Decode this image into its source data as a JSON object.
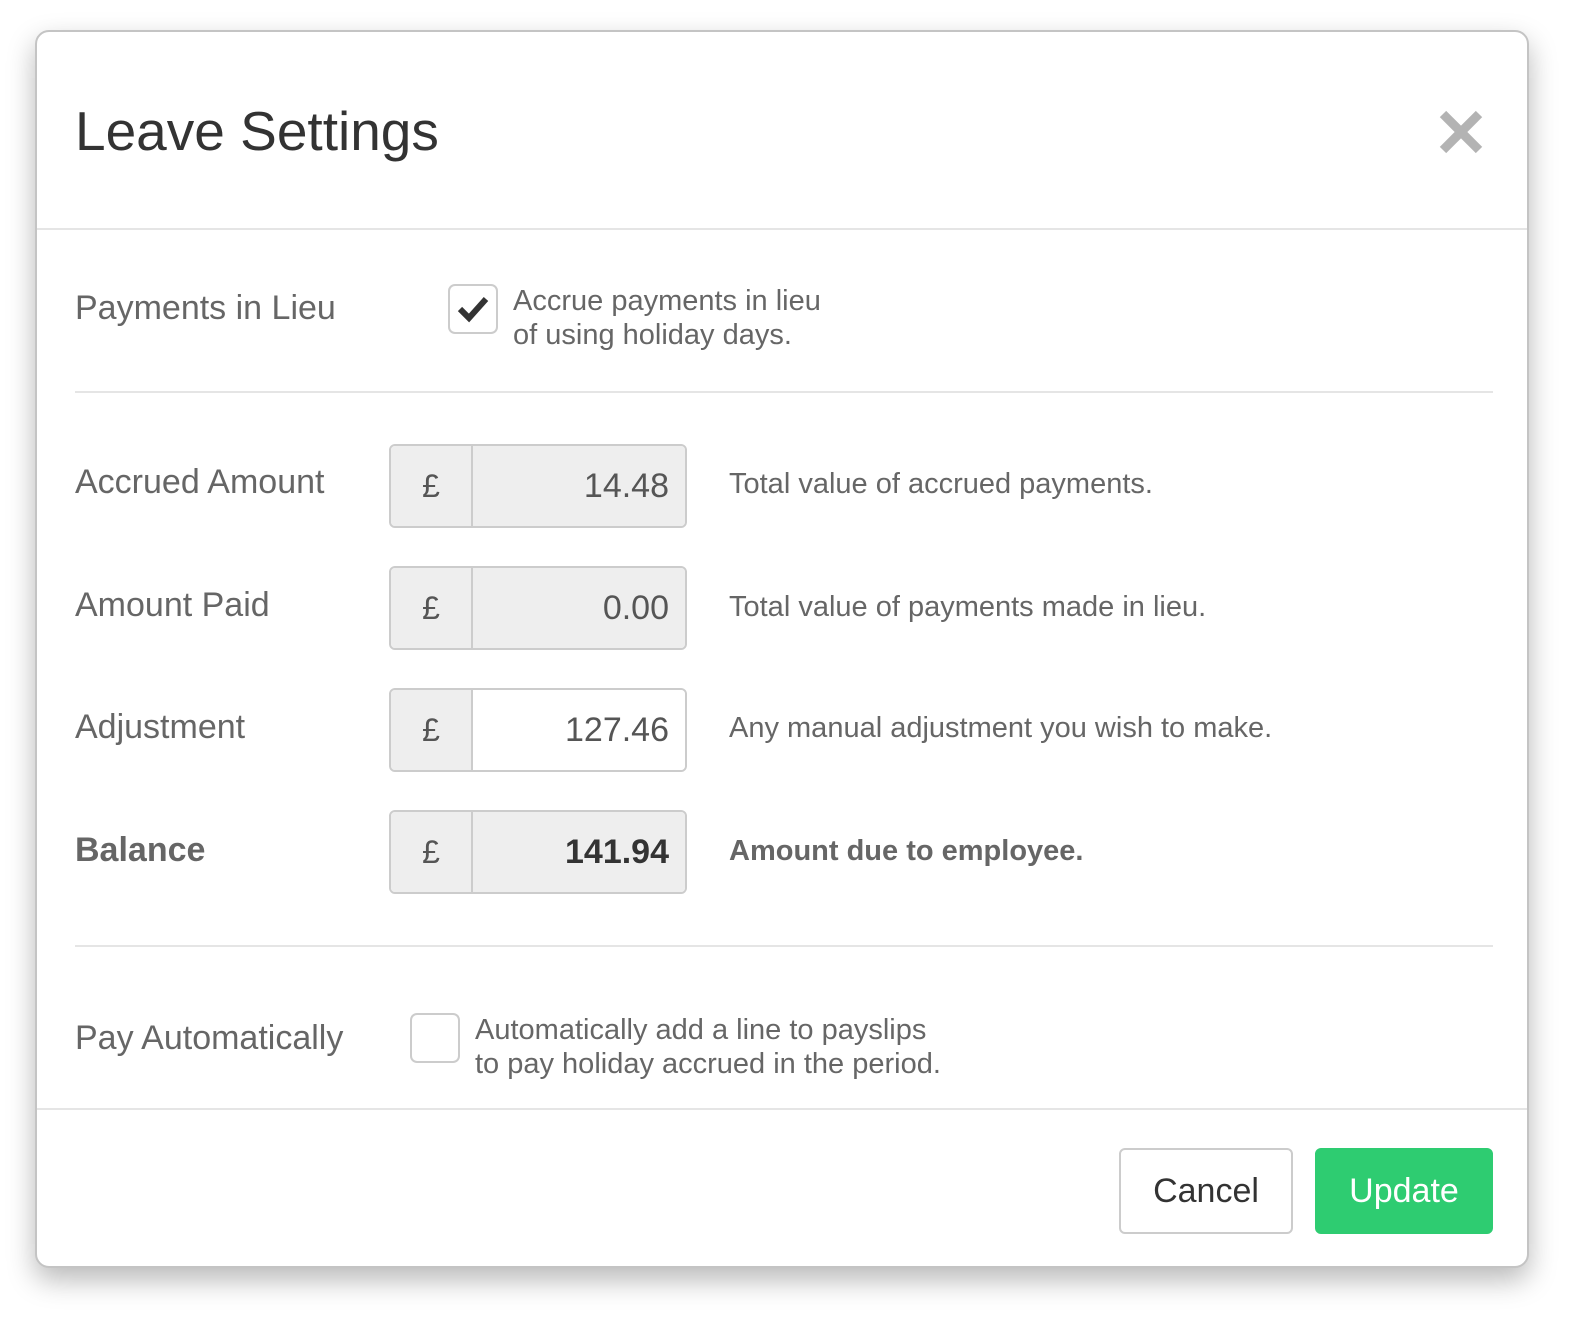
{
  "dialog": {
    "title": "Leave Settings"
  },
  "payments_in_lieu": {
    "label": "Payments in Lieu",
    "checked": true,
    "description_line1": "Accrue payments in lieu",
    "description_line2": "of using holiday days."
  },
  "currency_symbol": "£",
  "fields": {
    "accrued_amount": {
      "label": "Accrued Amount",
      "value": "14.48",
      "help": "Total value of accrued payments."
    },
    "amount_paid": {
      "label": "Amount Paid",
      "value": "0.00",
      "help": "Total value of payments made in lieu."
    },
    "adjustment": {
      "label": "Adjustment",
      "value": "127.46",
      "help": "Any manual adjustment you wish to make."
    },
    "balance": {
      "label": "Balance",
      "value": "141.94",
      "help": "Amount due to employee."
    }
  },
  "pay_automatically": {
    "label": "Pay Automatically",
    "checked": false,
    "description_line1": "Automatically add a line to payslips",
    "description_line2": "to pay holiday accrued in the period."
  },
  "footer": {
    "cancel_label": "Cancel",
    "update_label": "Update"
  },
  "colors": {
    "primary": "#2ecc71",
    "text": "#666666",
    "readonly_bg": "#eeeeee"
  }
}
